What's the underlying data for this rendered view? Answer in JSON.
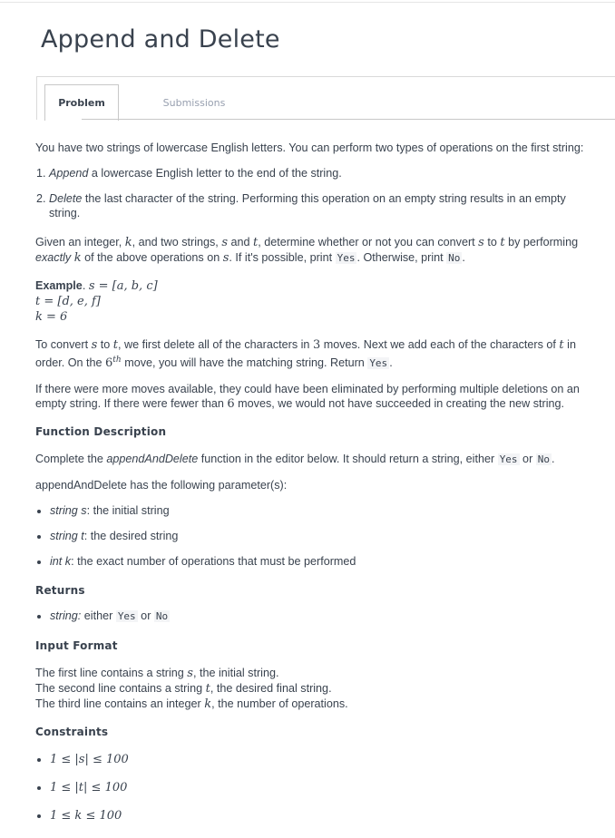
{
  "header": {
    "title": "Append and Delete"
  },
  "tabs": [
    {
      "label": "Problem",
      "active": true
    },
    {
      "label": "Submissions",
      "active": false
    }
  ],
  "problem": {
    "intro": "You have two strings of lowercase English letters. You can perform two types of operations on the first string:",
    "op1_em": "Append",
    "op1_rest": " a lowercase English letter to the end of the string.",
    "op2_em": "Delete",
    "op2_rest": " the last character of the string. Performing this operation on an empty string results in an empty string.",
    "given_a": "Given an integer, ",
    "given_b": ", and two strings, ",
    "given_c": " and ",
    "given_d": ", determine whether or not you can convert ",
    "given_e": " to ",
    "given_f": " by performing ",
    "given_exactly": "exactly",
    "given_g": " of the above operations on ",
    "given_h": ". If it's possible, print ",
    "given_i": ". Otherwise, print ",
    "given_j": ".",
    "yes": "Yes",
    "no": "No",
    "example_label": "Example",
    "example_s": "s = [a, b, c]",
    "example_t": "t = [d, e, f]",
    "example_k": "k = 6",
    "convert_a": "To convert ",
    "convert_b": " to ",
    "convert_c": ", we first delete all of the characters in ",
    "convert_3": "3",
    "convert_d": " moves. Next we add each of the characters of ",
    "convert_e": " in order. On the ",
    "convert_6": "6",
    "convert_th": "th",
    "convert_f": " move, you will have the matching string. Return ",
    "convert_g": ".",
    "more_a": "If there were more moves available, they could have been eliminated by performing multiple deletions on an empty string. If there were fewer than ",
    "more_6": "6",
    "more_b": " moves, we would not have succeeded in creating the new string."
  },
  "function_description": {
    "heading": "Function Description",
    "complete_a": "Complete the ",
    "complete_fn": "appendAndDelete",
    "complete_b": " function in the editor below. It should return a string, either ",
    "complete_or": " or ",
    "complete_c": ".",
    "params_intro": "appendAndDelete has the following parameter(s):",
    "params": [
      {
        "type": "string s",
        "desc": ": the initial string"
      },
      {
        "type": "string t",
        "desc": ": the desired string"
      },
      {
        "type": "int k",
        "desc": ": the exact number of operations that must be performed"
      }
    ]
  },
  "returns": {
    "heading": "Returns",
    "type": "string:",
    "text_a": " either ",
    "text_or": " or "
  },
  "input_format": {
    "heading": "Input Format",
    "line1_a": "The first line contains a string ",
    "line1_b": ", the initial string.",
    "line2_a": "The second line contains a string ",
    "line2_b": ", the desired final string.",
    "line3_a": "The third line contains an integer ",
    "line3_b": ", the number of operations."
  },
  "constraints": {
    "heading": "Constraints",
    "items": [
      "1 ≤ |s| ≤ 100",
      "1 ≤ |t| ≤ 100",
      "1 ≤ k ≤ 100"
    ]
  },
  "vars": {
    "s": "s",
    "t": "t",
    "k": "k"
  }
}
